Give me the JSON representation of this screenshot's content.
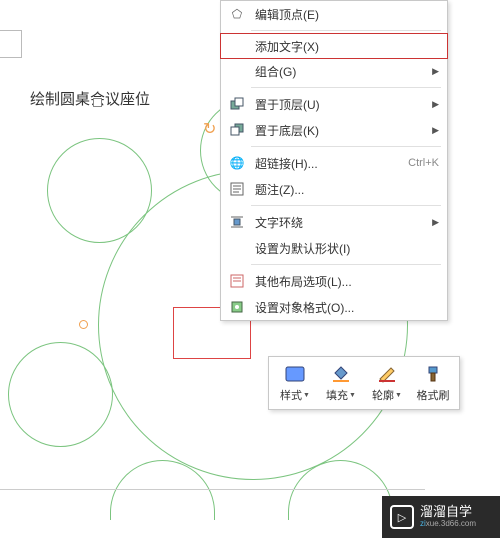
{
  "canvas": {
    "title": "绘制圆桌会议座位"
  },
  "contextMenu": {
    "items": [
      {
        "label": "编辑顶点(E)",
        "icon": "edit-points"
      },
      {
        "label": "添加文字(X)",
        "highlighted": true
      },
      {
        "label": "组合(G)",
        "submenu": true
      },
      {
        "label": "置于顶层(U)",
        "icon": "bring-front",
        "submenu": true
      },
      {
        "label": "置于底层(K)",
        "icon": "send-back",
        "submenu": true
      },
      {
        "label": "超链接(H)...",
        "icon": "hyperlink",
        "shortcut": "Ctrl+K"
      },
      {
        "label": "题注(Z)...",
        "icon": "caption"
      },
      {
        "label": "文字环绕",
        "icon": "wrap-text",
        "submenu": true
      },
      {
        "label": "设置为默认形状(I)"
      },
      {
        "label": "其他布局选项(L)...",
        "icon": "layout"
      },
      {
        "label": "设置对象格式(O)...",
        "icon": "format"
      }
    ]
  },
  "miniToolbar": {
    "tools": [
      {
        "label": "样式",
        "icon": "style",
        "dropdown": true
      },
      {
        "label": "填充",
        "icon": "fill",
        "dropdown": true
      },
      {
        "label": "轮廓",
        "icon": "outline",
        "dropdown": true
      },
      {
        "label": "格式刷",
        "icon": "format-painter"
      }
    ]
  },
  "watermark": {
    "main": "溜溜自学",
    "sub_prefix": "zi",
    "sub_rest": "xue.3d66.com"
  }
}
